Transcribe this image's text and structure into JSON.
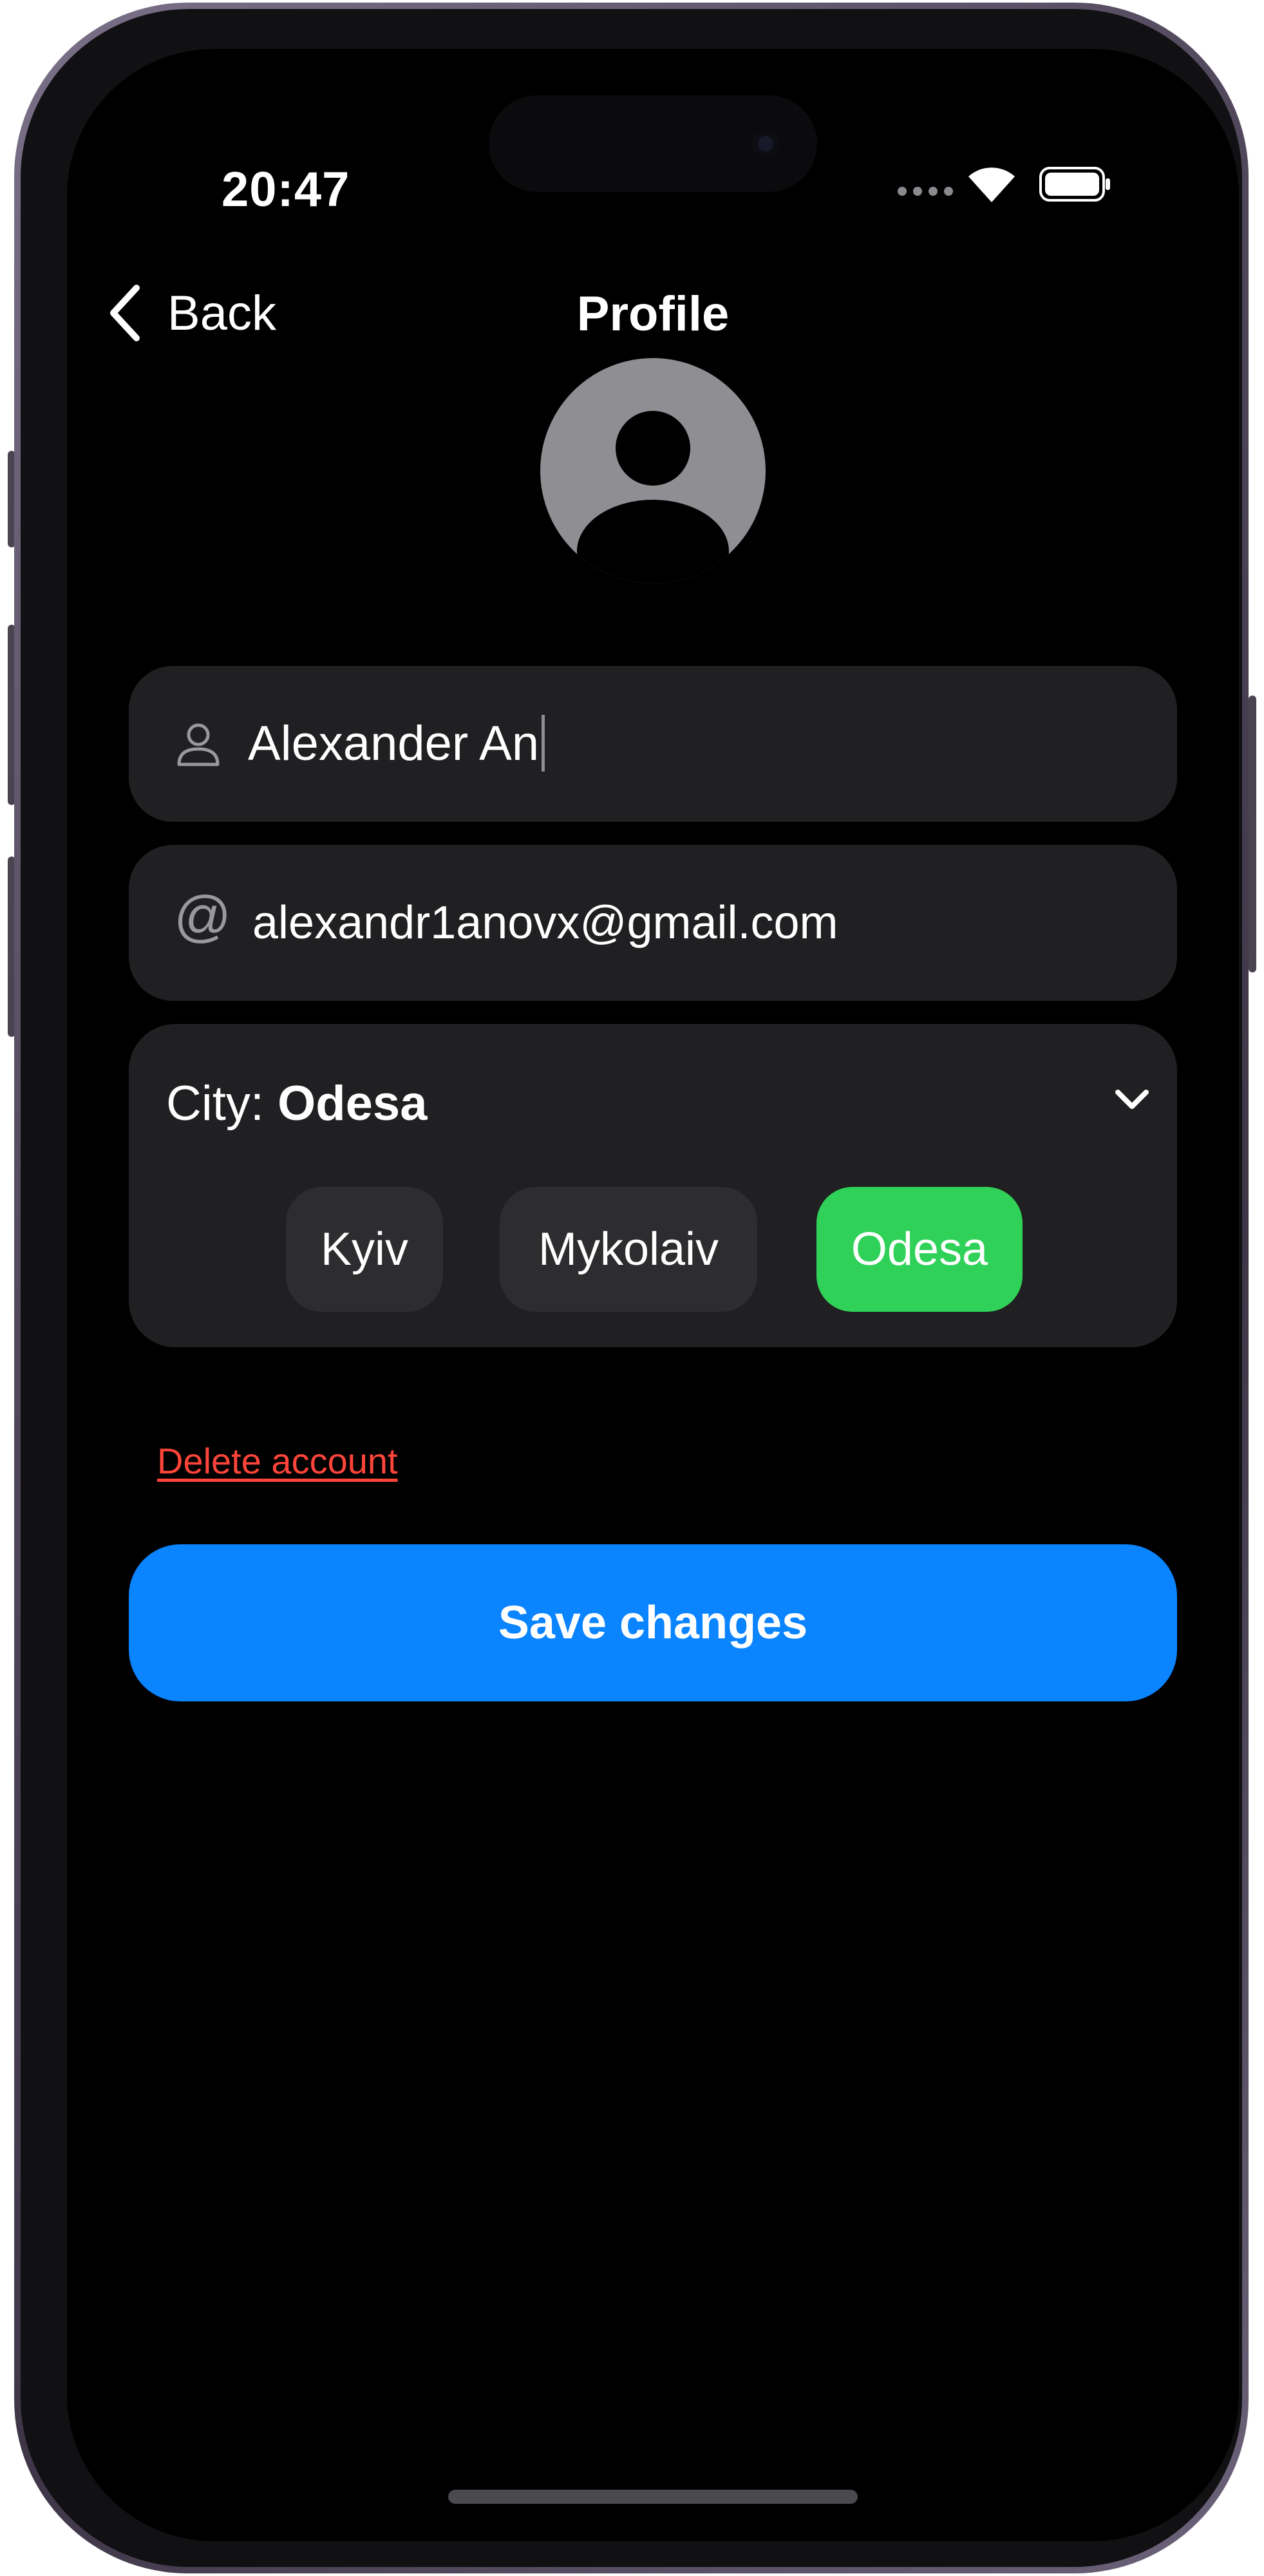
{
  "status_bar": {
    "time": "20:47",
    "icons": [
      "signal-icon",
      "wifi-icon",
      "battery-icon"
    ]
  },
  "nav": {
    "back_label": "Back",
    "title": "Profile"
  },
  "profile": {
    "name_value": "Alexander An",
    "email_value": "alexandr1anovx@gmail.com",
    "at_symbol": "@"
  },
  "city": {
    "label": "City:",
    "selected": "Odesa",
    "options": [
      "Kyiv",
      "Mykolaiv",
      "Odesa"
    ]
  },
  "actions": {
    "delete_label": "Delete account",
    "save_label": "Save changes"
  },
  "colors": {
    "background": "#000000",
    "field_bg": "#202022",
    "accent_blue": "#0a84ff",
    "selected_green": "#30d158",
    "danger_red": "#ff453a"
  }
}
